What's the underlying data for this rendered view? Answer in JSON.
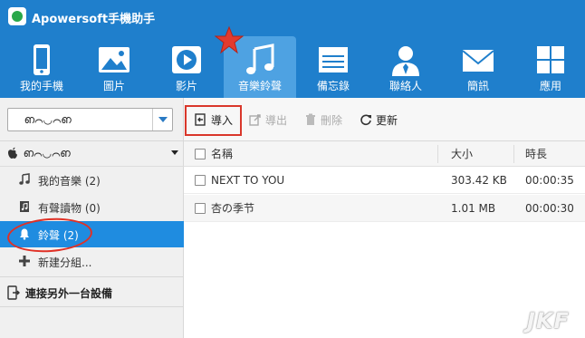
{
  "app": {
    "title": "Apowersoft手機助手"
  },
  "nav": [
    {
      "label": "我的手機",
      "icon": "phone-icon"
    },
    {
      "label": "圖片",
      "icon": "picture-icon"
    },
    {
      "label": "影片",
      "icon": "video-play-icon"
    },
    {
      "label": "音樂鈴聲",
      "icon": "music-note-icon",
      "active": true
    },
    {
      "label": "備忘錄",
      "icon": "notes-icon"
    },
    {
      "label": "聯絡人",
      "icon": "contact-person-icon"
    },
    {
      "label": "簡訊",
      "icon": "envelope-icon"
    },
    {
      "label": "應用",
      "icon": "apps-grid-icon"
    }
  ],
  "device_select": {
    "value": "ഩ⌒◡⌒ഩ"
  },
  "toolbar": {
    "import": "導入",
    "export": "導出",
    "delete": "刪除",
    "refresh": "更新"
  },
  "sidebar": {
    "device_name": "ഩ⌒◡⌒ഩ",
    "items": [
      {
        "label": "我的音樂 (2)",
        "icon": "music-note-icon"
      },
      {
        "label": "有聲讀物 (0)",
        "icon": "audiobook-icon"
      },
      {
        "label": "鈴聲 (2)",
        "icon": "bell-icon",
        "active": true
      },
      {
        "label": "新建分組...",
        "icon": "plus-icon"
      }
    ],
    "connect": "連接另外一台設備"
  },
  "list": {
    "columns": {
      "name": "名稱",
      "size": "大小",
      "duration": "時長"
    },
    "rows": [
      {
        "name": "NEXT TO YOU",
        "size": "303.42 KB",
        "duration": "00:00:35"
      },
      {
        "name": "杏の季节",
        "size": "1.01 MB",
        "duration": "00:00:30"
      }
    ]
  },
  "watermark": "JKF",
  "colors": {
    "header": "#1f7fcc",
    "active_nav": "#4ea2e2",
    "active_row": "#1f8ce0",
    "annotation_red": "#d9372b"
  }
}
